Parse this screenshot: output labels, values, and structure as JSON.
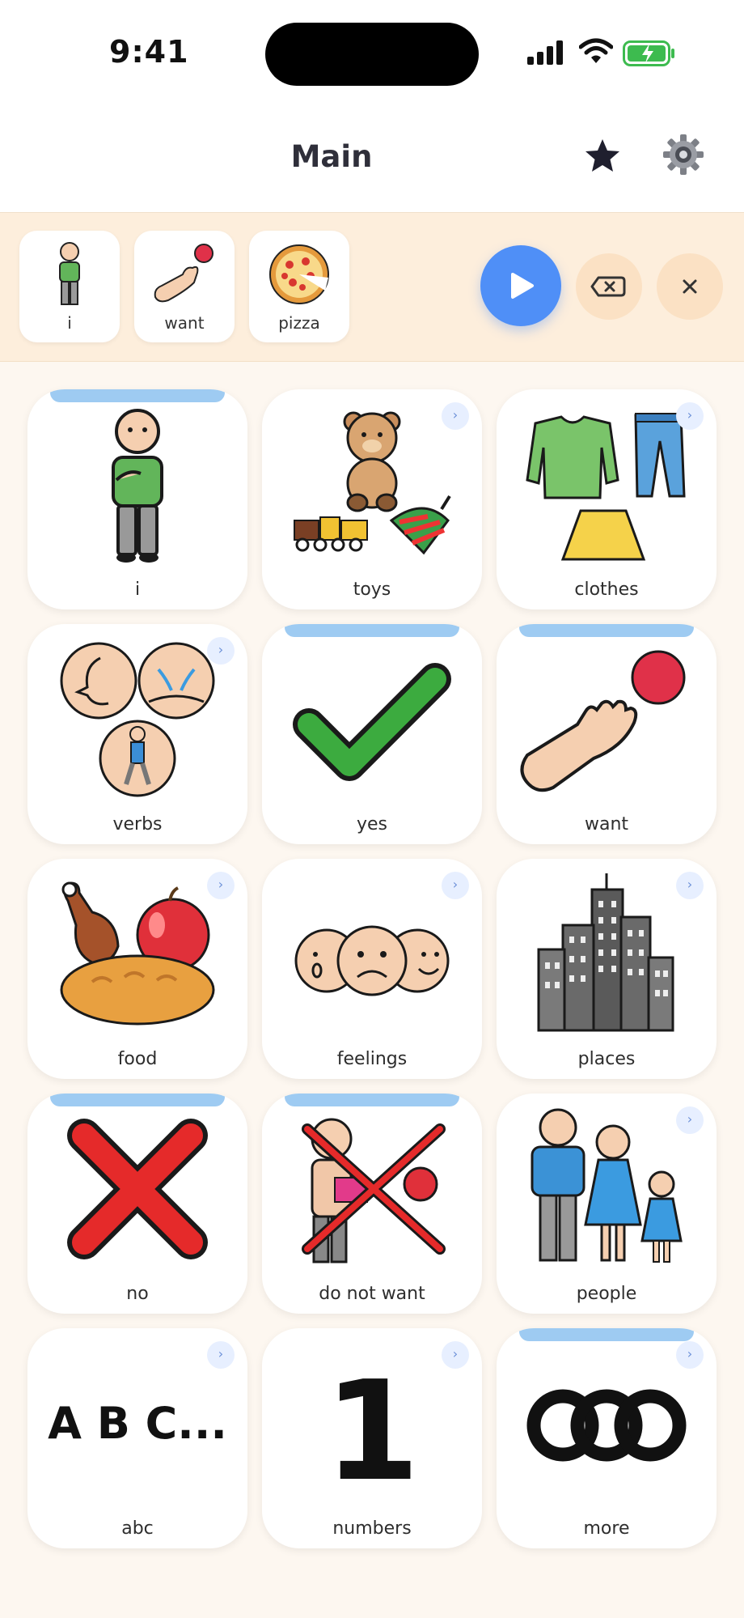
{
  "status": {
    "time": "9:41"
  },
  "header": {
    "title": "Main"
  },
  "sentence": [
    {
      "label": "i",
      "icon": "person-icon"
    },
    {
      "label": "want",
      "icon": "reach-hand-icon"
    },
    {
      "label": "pizza",
      "icon": "pizza-icon"
    }
  ],
  "tiles": [
    {
      "label": "i",
      "icon": "person-icon",
      "folder": false
    },
    {
      "label": "toys",
      "icon": "toys-icon",
      "folder": true
    },
    {
      "label": "clothes",
      "icon": "clothes-icon",
      "folder": true
    },
    {
      "label": "verbs",
      "icon": "verbs-icon",
      "folder": true
    },
    {
      "label": "yes",
      "icon": "check-icon",
      "folder": false
    },
    {
      "label": "want",
      "icon": "reach-hand-icon",
      "folder": false
    },
    {
      "label": "food",
      "icon": "food-icon",
      "folder": true
    },
    {
      "label": "feelings",
      "icon": "faces-icon",
      "folder": true
    },
    {
      "label": "places",
      "icon": "buildings-icon",
      "folder": true
    },
    {
      "label": "no",
      "icon": "cross-icon",
      "folder": false
    },
    {
      "label": "do not want",
      "icon": "refuse-icon",
      "folder": false
    },
    {
      "label": "people",
      "icon": "family-icon",
      "folder": true
    },
    {
      "label": "abc",
      "icon": "letters-icon",
      "folder": true,
      "art_text": "A B C..."
    },
    {
      "label": "numbers",
      "icon": "number-icon",
      "folder": true,
      "art_text": "1"
    },
    {
      "label": "more",
      "icon": "circles-icon",
      "folder": true
    }
  ],
  "colors": {
    "accent": "#4f8ff7",
    "strip": "#fdeedc",
    "core_band": "#9ecbf2"
  }
}
